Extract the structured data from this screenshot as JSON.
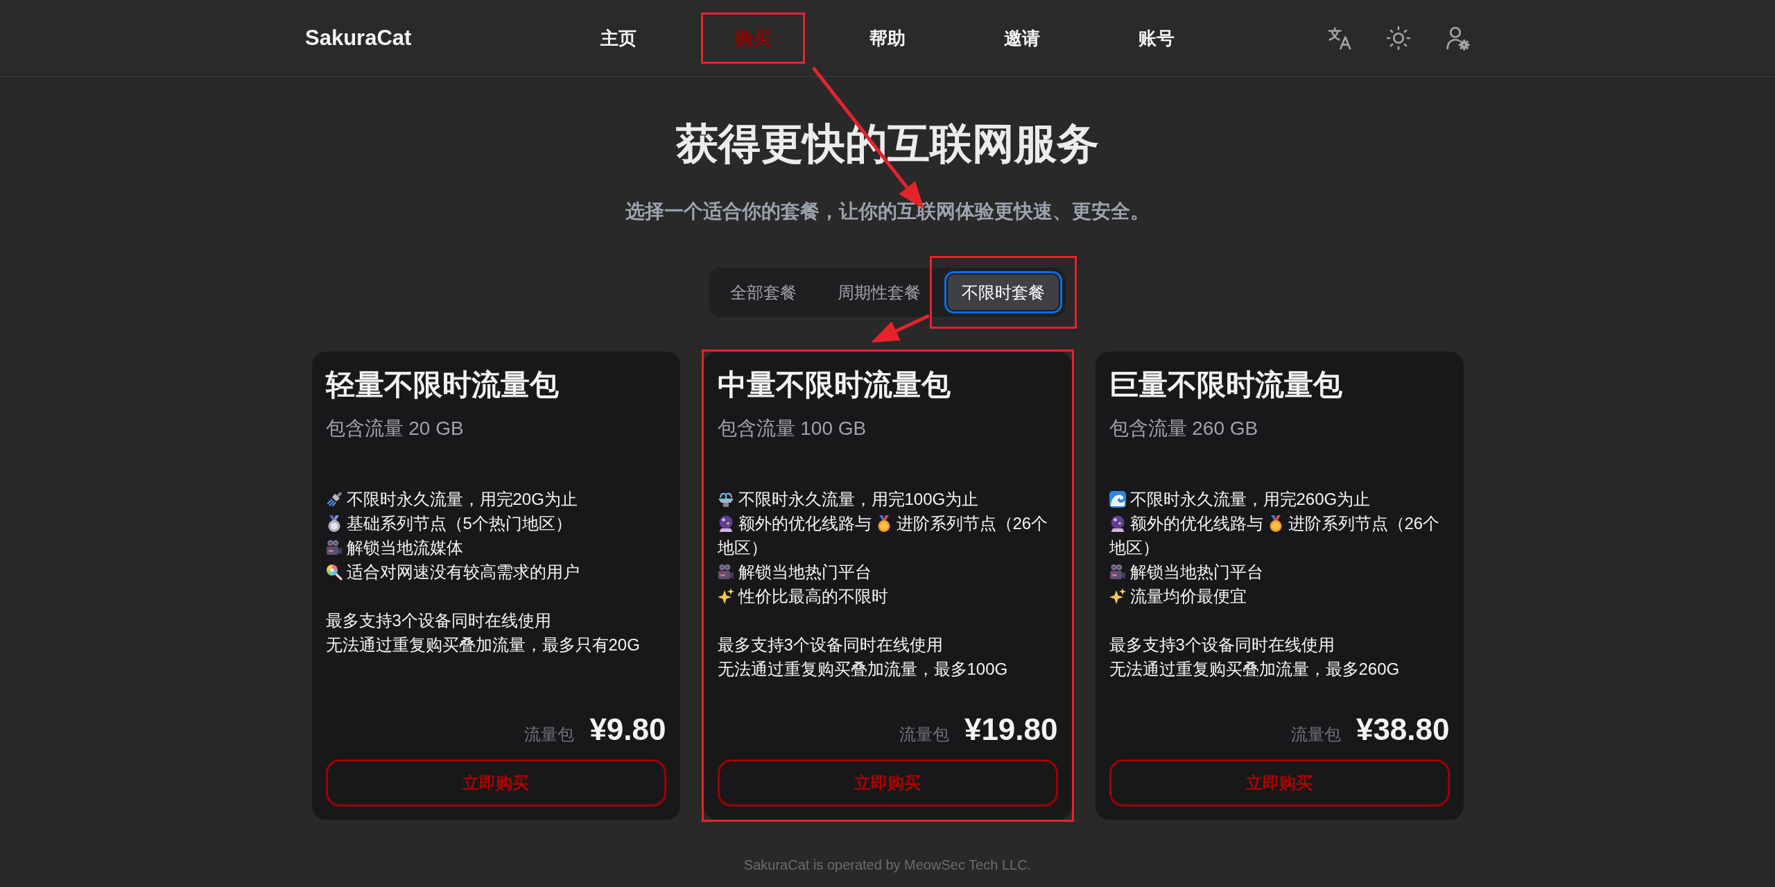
{
  "header": {
    "logo": "SakuraCat",
    "nav": [
      {
        "label": "主页",
        "selected": false,
        "highlighted": false
      },
      {
        "label": "购买",
        "selected": true,
        "highlighted": true
      },
      {
        "label": "帮助",
        "selected": false,
        "highlighted": false
      },
      {
        "label": "邀请",
        "selected": false,
        "highlighted": false
      },
      {
        "label": "账号",
        "selected": false,
        "highlighted": false
      }
    ]
  },
  "hero": {
    "title": "获得更快的互联网服务",
    "subtitle": "选择一个适合你的套餐，让你的互联网体验更快速、更安全。"
  },
  "tabs": [
    {
      "label": "全部套餐",
      "selected": false,
      "highlighted": false
    },
    {
      "label": "周期性套餐",
      "selected": false,
      "highlighted": false
    },
    {
      "label": "不限时套餐",
      "selected": true,
      "highlighted": true
    }
  ],
  "plans": [
    {
      "name": "轻量不限时流量包",
      "traffic": "包含流量 20 GB",
      "features": [
        {
          "kind": "shower",
          "text": "不限时永久流量，用完20G为止"
        },
        {
          "kind": "medal-2",
          "text": "基础系列节点（5个热门地区）"
        },
        {
          "kind": "movie-camera",
          "text": "解锁当地流媒体"
        },
        {
          "kind": "lollipop",
          "text": "适合对网速没有较高需求的用户"
        }
      ],
      "notes": [
        "最多支持3个设备同时在线使用",
        "无法通过重复购买叠加流量，最多只有20G"
      ],
      "price_unit": "流量包",
      "price": "¥9.80",
      "button": "立即购买",
      "highlighted": false
    },
    {
      "name": "中量不限时流量包",
      "traffic": "包含流量 100 GB",
      "features": [
        {
          "kind": "fountain",
          "text": "不限时永久流量，用完100G为止"
        },
        {
          "kind": "crystal-ball",
          "text": "额外的优化线路与",
          "inline_icon": {
            "kind": "medal-1"
          },
          "text_after": "进阶系列节点（26个",
          "text_wrapped": "地区）"
        },
        {
          "kind": "movie-camera",
          "text": "解锁当地热门平台"
        },
        {
          "kind": "sparkles",
          "text": "性价比最高的不限时"
        }
      ],
      "notes": [
        "最多支持3个设备同时在线使用",
        "无法通过重复购买叠加流量，最多100G"
      ],
      "price_unit": "流量包",
      "price": "¥19.80",
      "button": "立即购买",
      "highlighted": true
    },
    {
      "name": "巨量不限时流量包",
      "traffic": "包含流量 260 GB",
      "features": [
        {
          "kind": "wave",
          "text": "不限时永久流量，用完260G为止"
        },
        {
          "kind": "crystal-ball",
          "text": "额外的优化线路与",
          "inline_icon": {
            "kind": "medal-1"
          },
          "text_after": "进阶系列节点（26个",
          "text_wrapped": "地区）"
        },
        {
          "kind": "movie-camera",
          "text": "解锁当地热门平台"
        },
        {
          "kind": "sparkles",
          "text": "流量均价最便宜"
        }
      ],
      "notes": [
        "最多支持3个设备同时在线使用",
        "无法通过重复购买叠加流量，最多260G"
      ],
      "price_unit": "流量包",
      "price": "¥38.80",
      "button": "立即购买",
      "highlighted": false
    }
  ],
  "footer": "SakuraCat is operated by MeowSec Tech LLC."
}
